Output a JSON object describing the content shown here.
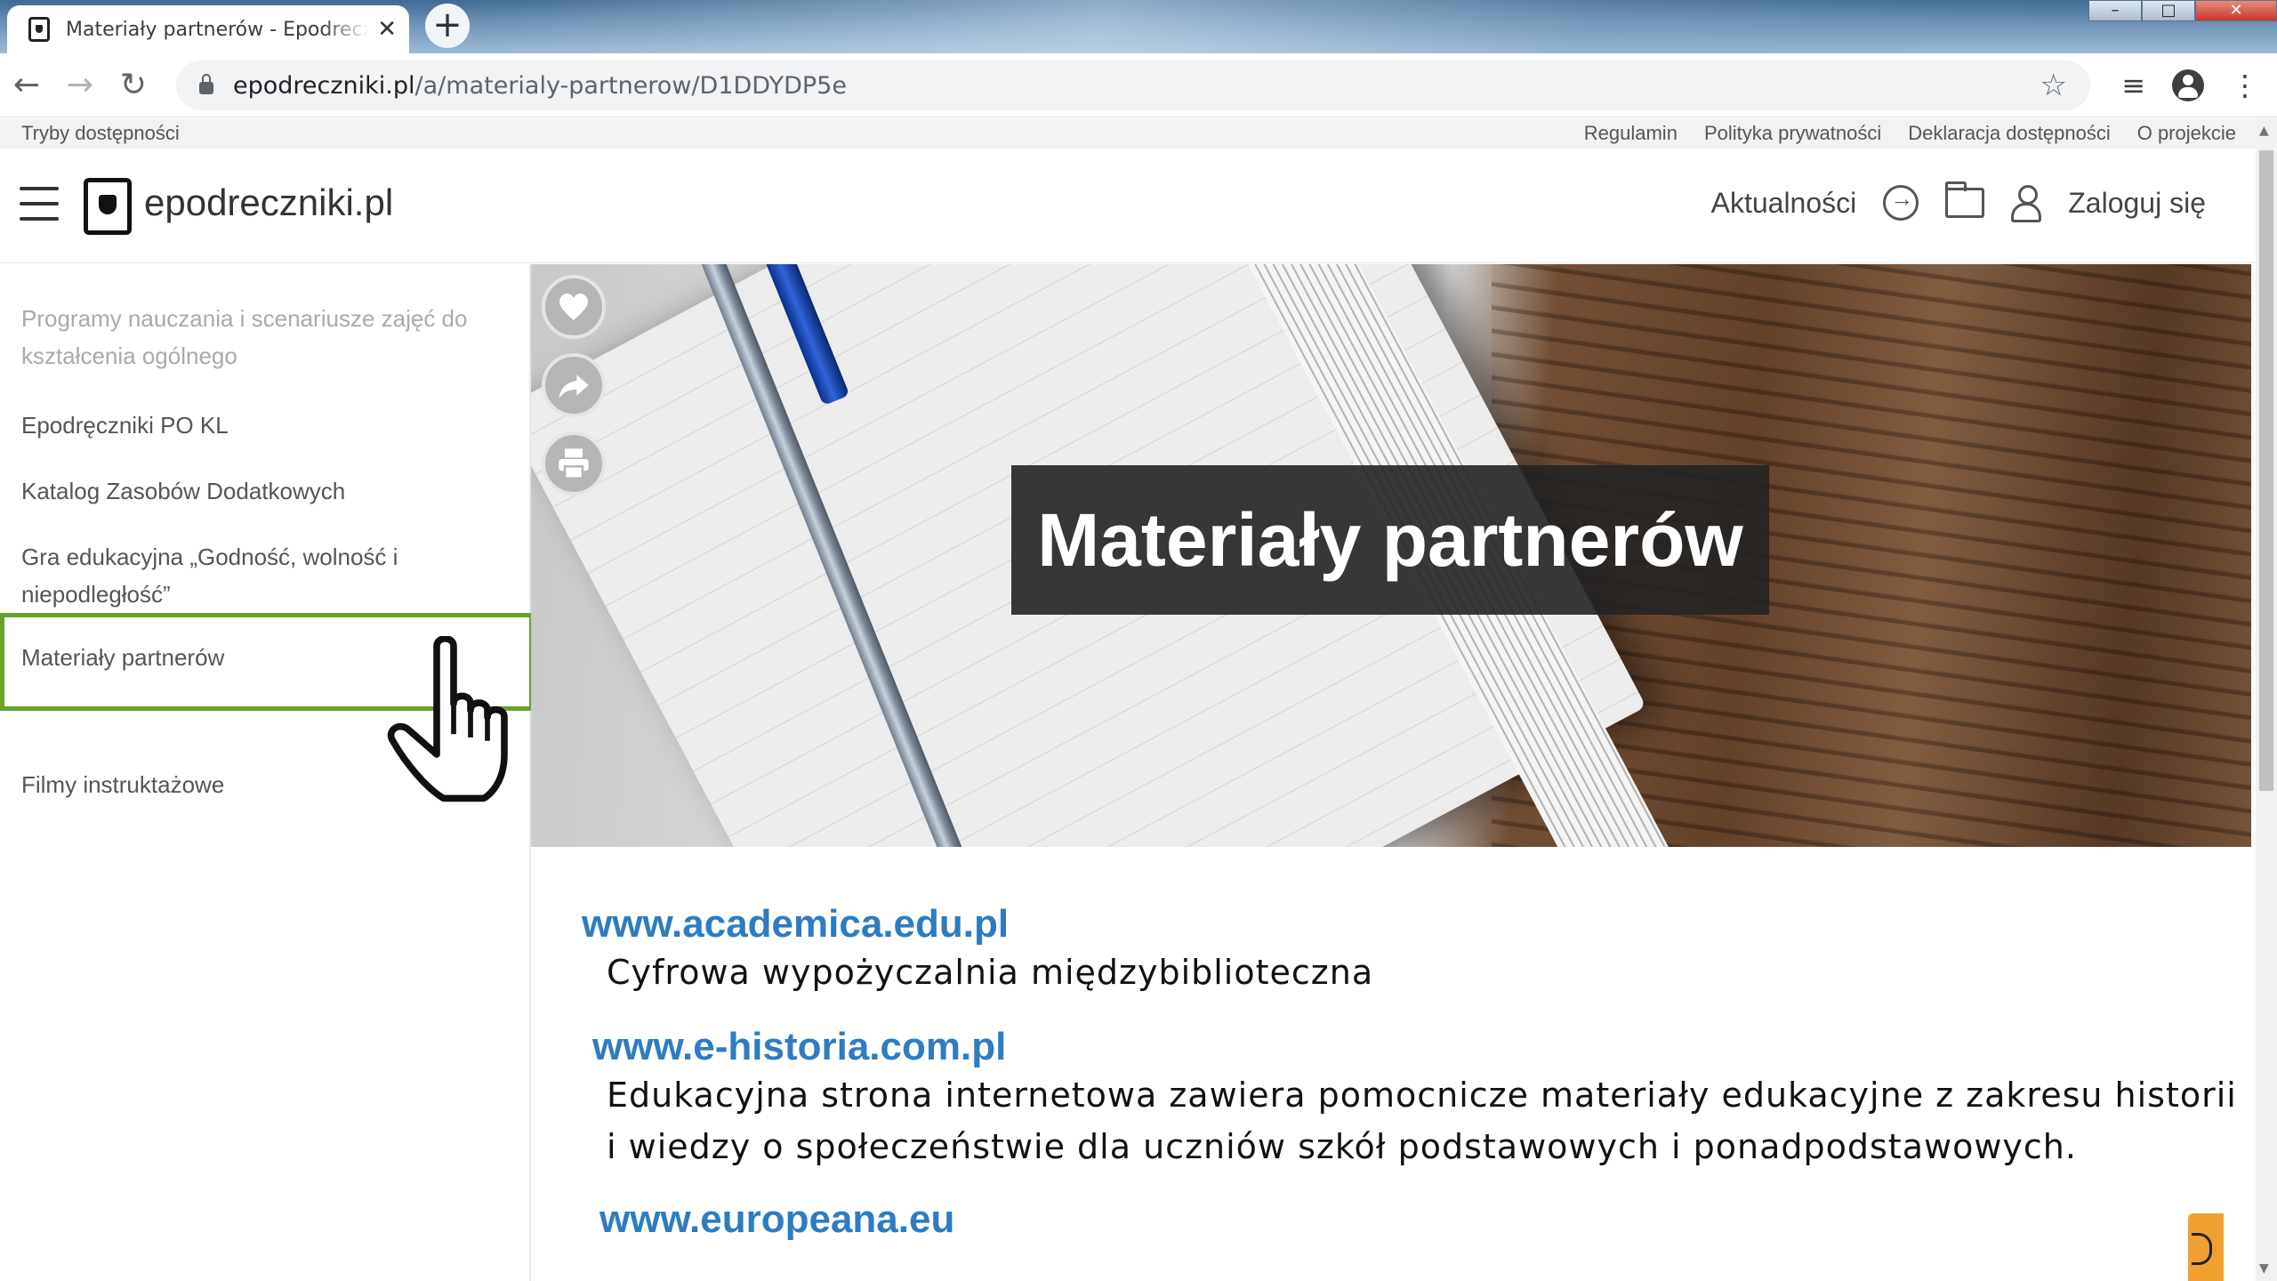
{
  "browser": {
    "tab_title": "Materiały partnerów - Epodreczniki",
    "tab_close": "✕",
    "new_tab": "+",
    "url_host": "epodreczniki.pl",
    "url_path": "/a/materialy-partnerow/D1DDYDP5e"
  },
  "topbar": {
    "left_link": "Tryby dostępności",
    "links": [
      "Regulamin",
      "Polityka prywatności",
      "Deklaracja dostępności",
      "O projekcie"
    ]
  },
  "header": {
    "logo_text": "epodreczniki.pl",
    "news_label": "Aktualności",
    "login_label": "Zaloguj się"
  },
  "sidebar": {
    "items": [
      "Programy nauczania i scenariusze zajęć do kształcenia ogólnego",
      "Epodręczniki PO KL",
      "Katalog Zasobów Dodatkowych",
      "Gra edukacyjna „Godność, wolność i niepodległość”",
      "Materiały partnerów",
      "Filmy instruktażowe"
    ]
  },
  "hero": {
    "title": "Materiały partnerów"
  },
  "content": {
    "entries": [
      {
        "url": "www.academica.edu.pl",
        "description": "Cyfrowa wypożyczalnia międzybiblioteczna"
      },
      {
        "url": "www.e-historia.com.pl",
        "description_line1": "Edukacyjna strona internetowa zawiera pomocnicze materiały edukacyjne z zakresu historii",
        "description_line2": "i wiedzy o społeczeństwie dla uczniów szkół podstawowych i ponadpodstawowych."
      },
      {
        "url": "www.europeana.eu"
      }
    ]
  },
  "colors": {
    "highlight_border": "#6aa12f",
    "link": "#2d7cc1",
    "help_tab": "#f0a030"
  }
}
